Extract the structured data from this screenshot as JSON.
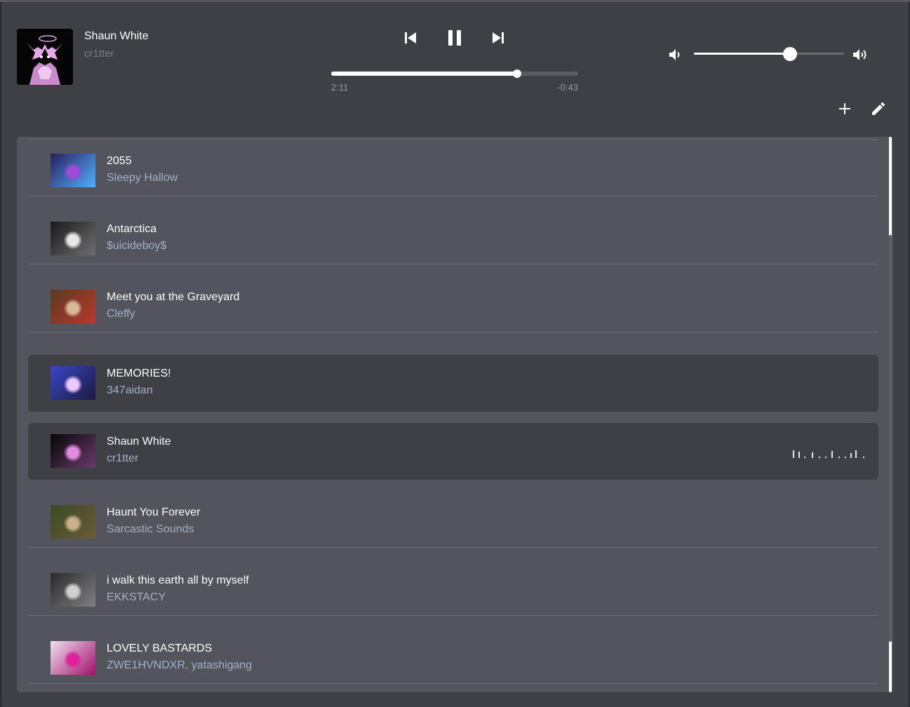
{
  "now_playing": {
    "title": "Shaun White",
    "artist": "cr1tter",
    "elapsed": "2:11",
    "remaining": "-0:43",
    "progress_fraction": 0.753,
    "volume_fraction": 0.64
  },
  "controls": {
    "prev_icon": "skip-previous-icon",
    "pause_icon": "pause-icon",
    "next_icon": "skip-next-icon",
    "volume_down_icon": "volume-down-icon",
    "volume_up_icon": "volume-up-icon",
    "add_icon": "plus-icon",
    "edit_icon": "pencil-icon"
  },
  "playlist": [
    {
      "title": "2055",
      "artist": "Sleepy Hallow",
      "highlighted": false,
      "playing": false,
      "art": [
        "#2a1f5e",
        "#a04ad8",
        "#4fb0ff"
      ]
    },
    {
      "title": "Antarctica",
      "artist": "$uicideboy$",
      "highlighted": false,
      "playing": false,
      "art": [
        "#1a1a1a",
        "#e8e8e8",
        "#6e6e6e"
      ]
    },
    {
      "title": "Meet you at the Graveyard",
      "artist": "Cleffy",
      "highlighted": false,
      "playing": false,
      "art": [
        "#5a3a22",
        "#d9b79a",
        "#b8392d"
      ]
    },
    {
      "title": "MEMORIES!",
      "artist": "347aidan",
      "highlighted": true,
      "playing": false,
      "art": [
        "#3c46c8",
        "#f0c8ff",
        "#1a1a40"
      ]
    },
    {
      "title": "Shaun White",
      "artist": "cr1tter",
      "highlighted": true,
      "playing": true,
      "art": [
        "#060606",
        "#e08ae0",
        "#6a3a6a"
      ]
    },
    {
      "title": "Haunt You Forever",
      "artist": "Sarcastic Sounds",
      "highlighted": false,
      "playing": false,
      "art": [
        "#3a4a22",
        "#c8b08a",
        "#6a5a3a"
      ]
    },
    {
      "title": "i walk this earth all by myself",
      "artist": "EKKSTACY",
      "highlighted": false,
      "playing": false,
      "art": [
        "#2a2a2a",
        "#d0d0d0",
        "#808080"
      ]
    },
    {
      "title": "LOVELY BASTARDS",
      "artist": "ZWE1HVNDXR, yatashigang",
      "highlighted": false,
      "playing": false,
      "art": [
        "#f0e0f0",
        "#e020a0",
        "#a0106a"
      ]
    }
  ],
  "colors": {
    "accent": "#ffffff",
    "artist_text": "#9fb0c8",
    "highlight_row": "#3f4046",
    "panel": "#54555c"
  }
}
